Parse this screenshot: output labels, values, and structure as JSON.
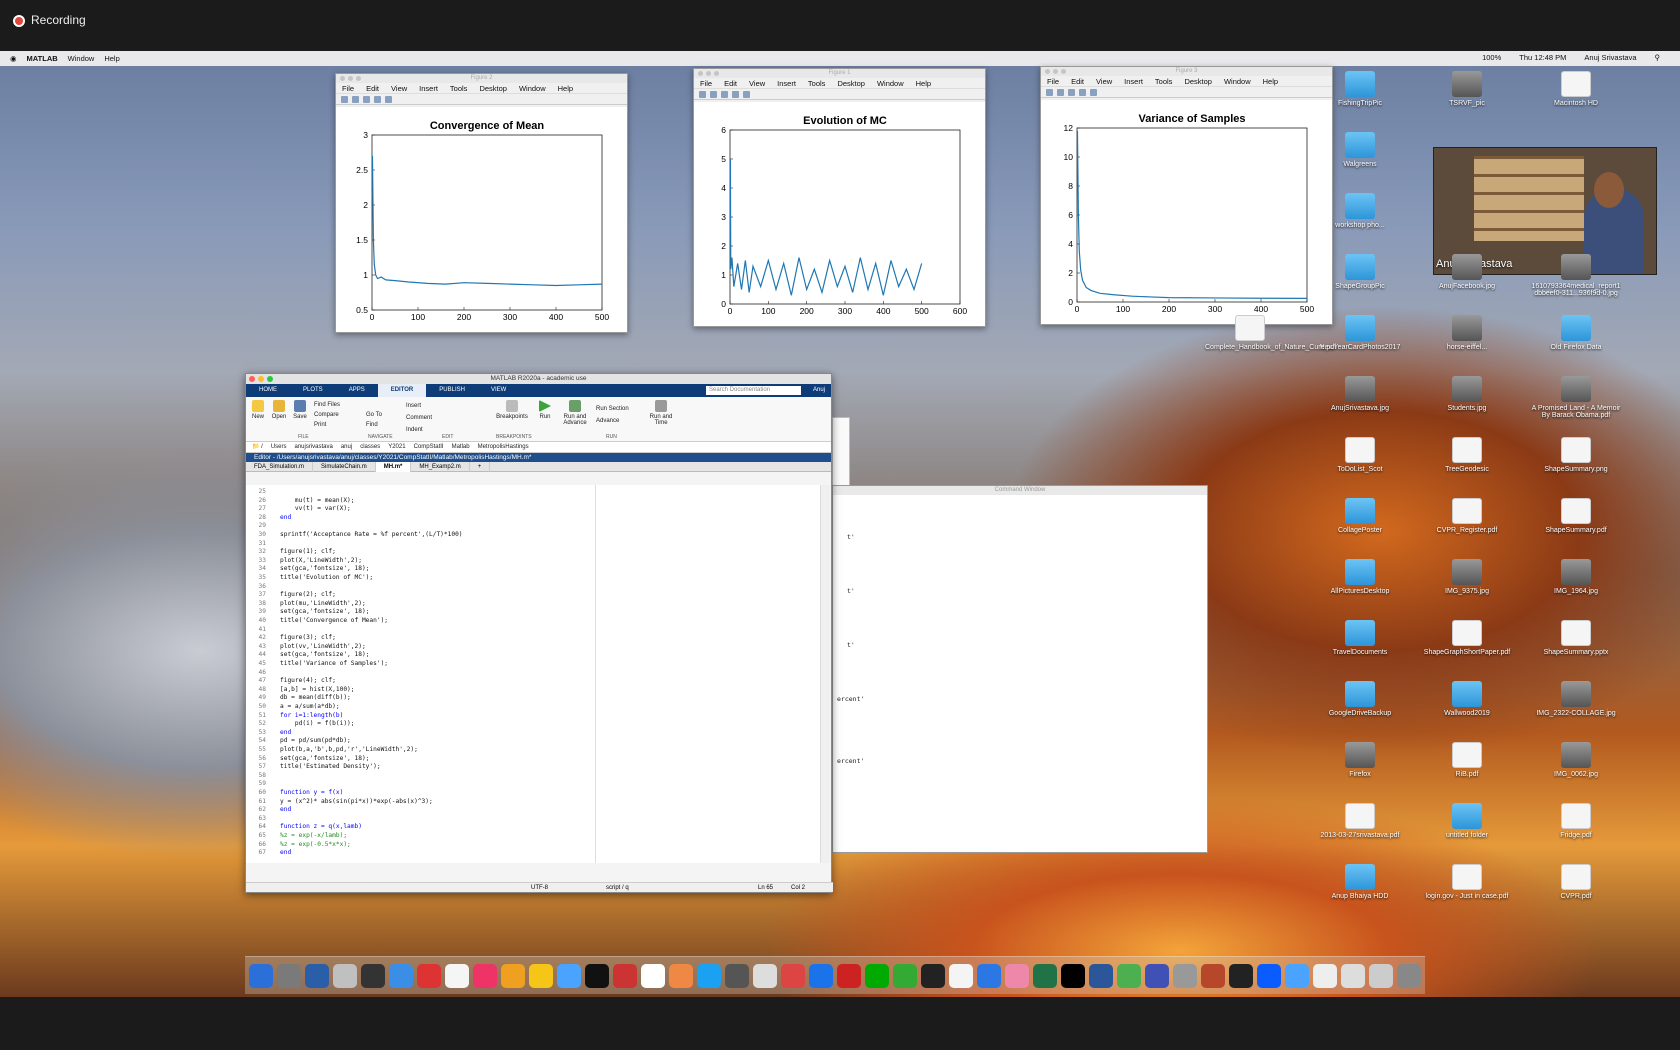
{
  "recording": {
    "label": "Recording"
  },
  "menubar": {
    "apple": "",
    "app": "MATLAB",
    "items": [
      "Window",
      "Help"
    ],
    "time": "Thu 12:48 PM",
    "user": "Anuj Srivastava",
    "battery": "100%"
  },
  "figures": [
    {
      "title": "Figure 2",
      "menu": [
        "File",
        "Edit",
        "View",
        "Insert",
        "Tools",
        "Desktop",
        "Window",
        "Help"
      ]
    },
    {
      "title": "Figure 1",
      "menu": [
        "File",
        "Edit",
        "View",
        "Insert",
        "Tools",
        "Desktop",
        "Window",
        "Help"
      ]
    },
    {
      "title": "Figure 3",
      "menu": [
        "File",
        "Edit",
        "View",
        "Insert",
        "Tools",
        "Desktop",
        "Window",
        "Help"
      ]
    }
  ],
  "chart_data": [
    {
      "type": "line",
      "title": "Convergence of Mean",
      "xlim": [
        0,
        500
      ],
      "ylim": [
        0.5,
        3
      ],
      "xticks": [
        "0",
        "100",
        "200",
        "300",
        "400",
        "500"
      ],
      "yticks": [
        "0.5",
        "1",
        "1.5",
        "2",
        "2.5",
        "3"
      ],
      "series": [
        {
          "x": [
            1,
            3,
            5,
            8,
            12,
            20,
            30,
            50,
            80,
            120,
            160,
            200,
            250,
            300,
            350,
            400,
            450,
            500
          ],
          "y": [
            2.7,
            1.5,
            1.15,
            1.0,
            0.95,
            0.97,
            0.93,
            0.92,
            0.9,
            0.88,
            0.87,
            0.89,
            0.88,
            0.87,
            0.86,
            0.85,
            0.86,
            0.87
          ]
        }
      ]
    },
    {
      "type": "line",
      "title": "Evolution of MC",
      "xlim": [
        0,
        600
      ],
      "ylim": [
        0,
        6
      ],
      "xticks": [
        "0",
        "100",
        "200",
        "300",
        "400",
        "500",
        "600"
      ],
      "yticks": [
        "0",
        "1",
        "2",
        "3",
        "4",
        "5",
        "6"
      ],
      "series": [
        {
          "x": [
            1,
            2,
            5,
            10,
            20,
            30,
            40,
            50,
            60,
            80,
            100,
            120,
            140,
            160,
            180,
            200,
            220,
            240,
            260,
            280,
            300,
            320,
            340,
            360,
            380,
            400,
            420,
            440,
            460,
            480,
            500
          ],
          "y": [
            5.0,
            1.2,
            1.6,
            0.6,
            1.4,
            0.5,
            1.5,
            0.4,
            1.3,
            0.6,
            1.5,
            0.5,
            1.4,
            0.3,
            1.6,
            0.5,
            1.2,
            0.4,
            1.5,
            0.6,
            1.3,
            0.4,
            1.6,
            0.5,
            1.4,
            0.3,
            1.5,
            0.6,
            1.2,
            0.5,
            1.4
          ]
        }
      ]
    },
    {
      "type": "line",
      "title": "Variance of Samples",
      "xlim": [
        0,
        500
      ],
      "ylim": [
        0,
        12
      ],
      "xticks": [
        "0",
        "100",
        "200",
        "300",
        "400",
        "500"
      ],
      "yticks": [
        "0",
        "2",
        "4",
        "6",
        "8",
        "10",
        "12"
      ],
      "series": [
        {
          "x": [
            1,
            3,
            5,
            8,
            12,
            20,
            30,
            50,
            80,
            120,
            160,
            200,
            300,
            400,
            500
          ],
          "y": [
            11.8,
            6.0,
            3.5,
            2.2,
            1.5,
            1.0,
            0.8,
            0.6,
            0.5,
            0.4,
            0.35,
            0.3,
            0.28,
            0.26,
            0.25
          ]
        }
      ]
    }
  ],
  "matlab": {
    "title": "MATLAB R2020a - academic use",
    "tabs": [
      "HOME",
      "PLOTS",
      "APPS",
      "EDITOR",
      "PUBLISH",
      "VIEW"
    ],
    "search_placeholder": "Search Documentation",
    "user": "Anuj",
    "toolstrip": {
      "new": "New",
      "open": "Open",
      "save": "Save",
      "find_files": "Find Files",
      "compare": "Compare",
      "print": "Print",
      "goto": "Go To",
      "find": "Find",
      "insert": "Insert",
      "comment": "Comment",
      "indent": "Indent",
      "breakpoints": "Breakpoints",
      "run": "Run",
      "run_advance": "Run and Advance",
      "run_section": "Run Section",
      "advance": "Advance",
      "run_time": "Run and Time",
      "sections": [
        "FILE",
        "NAVIGATE",
        "EDIT",
        "BREAKPOINTS",
        "RUN"
      ]
    },
    "path": [
      "Users",
      "anujsrivastava",
      "anuj",
      "classes",
      "Y2021",
      "CompStatII",
      "Matlab",
      "MetropolisHastings"
    ],
    "editor_header": "Editor - /Users/anujsrivastava/anuj/classes/Y2021/CompStatII/Matlab/MetropolisHastings/MH.m*",
    "file_tabs": [
      "FDA_Simulation.m",
      "SimulateChain.m",
      "MH.m*",
      "MH_Examp2.m"
    ],
    "code": [
      {
        "n": "25",
        "t": ""
      },
      {
        "n": "26",
        "t": "    mu(t) = mean(X);"
      },
      {
        "n": "27",
        "t": "    vv(t) = var(X);"
      },
      {
        "n": "28",
        "t": "end"
      },
      {
        "n": "29",
        "t": ""
      },
      {
        "n": "30",
        "t": "sprintf('Acceptance Rate = %f percent',(L/T)*100)"
      },
      {
        "n": "31",
        "t": ""
      },
      {
        "n": "32",
        "t": "figure(1); clf;"
      },
      {
        "n": "33",
        "t": "plot(X,'LineWidth',2);"
      },
      {
        "n": "34",
        "t": "set(gca,'fontsize', 18);"
      },
      {
        "n": "35",
        "t": "title('Evolution of MC');"
      },
      {
        "n": "36",
        "t": ""
      },
      {
        "n": "37",
        "t": "figure(2); clf;"
      },
      {
        "n": "38",
        "t": "plot(mu,'LineWidth',2);"
      },
      {
        "n": "39",
        "t": "set(gca,'fontsize', 18);"
      },
      {
        "n": "40",
        "t": "title('Convergence of Mean');"
      },
      {
        "n": "41",
        "t": ""
      },
      {
        "n": "42",
        "t": "figure(3); clf;"
      },
      {
        "n": "43",
        "t": "plot(vv,'LineWidth',2);"
      },
      {
        "n": "44",
        "t": "set(gca,'fontsize', 18);"
      },
      {
        "n": "45",
        "t": "title('Variance of Samples');"
      },
      {
        "n": "46",
        "t": ""
      },
      {
        "n": "47",
        "t": "figure(4); clf;"
      },
      {
        "n": "48",
        "t": "[a,b] = hist(X,100);"
      },
      {
        "n": "49",
        "t": "db = mean(diff(b));"
      },
      {
        "n": "50",
        "t": "a = a/sum(a*db);"
      },
      {
        "n": "51",
        "t": "for i=1:length(b)"
      },
      {
        "n": "52",
        "t": "    pd(i) = f(b(i));"
      },
      {
        "n": "53",
        "t": "end"
      },
      {
        "n": "54",
        "t": "pd = pd/sum(pd*db);"
      },
      {
        "n": "55",
        "t": "plot(b,a,'b',b,pd,'r','LineWidth',2);"
      },
      {
        "n": "56",
        "t": "set(gca,'fontsize', 18);"
      },
      {
        "n": "57",
        "t": "title('Estimated Density');"
      },
      {
        "n": "58",
        "t": ""
      },
      {
        "n": "59",
        "t": ""
      },
      {
        "n": "60",
        "t": "function y = f(x)"
      },
      {
        "n": "61",
        "t": "y = (x^2)* abs(sin(pi*x))*exp(-abs(x)^3);"
      },
      {
        "n": "62",
        "t": "end"
      },
      {
        "n": "63",
        "t": ""
      },
      {
        "n": "64",
        "t": "function z = q(x,lamb)"
      },
      {
        "n": "65",
        "t": "%z = exp(-x/lamb);"
      },
      {
        "n": "66",
        "t": "%z = exp(-0.5*x*x);"
      },
      {
        "n": "67",
        "t": "end"
      }
    ],
    "status": {
      "encoding": "UTF-8",
      "type": "script / q",
      "ln": "Ln  65",
      "col": "Col  2"
    }
  },
  "command_window": {
    "title": "Command Window",
    "lines": [
      "t'",
      "t'",
      "t'",
      "ercent'",
      "ercent'"
    ]
  },
  "video": {
    "name": "Anuj Srivastava"
  },
  "desktop_icons": [
    {
      "label": "FishingTripPic",
      "kind": "folder",
      "col": 0,
      "row": 0
    },
    {
      "label": "TSRVF_pic",
      "kind": "img",
      "col": 1,
      "row": 0
    },
    {
      "label": "Macintosh HD",
      "kind": "doc",
      "col": 2,
      "row": 0
    },
    {
      "label": "Walgreens",
      "kind": "folder",
      "col": 0,
      "row": 1
    },
    {
      "label": "workshop pho...",
      "kind": "folder",
      "col": 0,
      "row": 2
    },
    {
      "label": "ShapeGroupPic",
      "kind": "folder",
      "col": 0,
      "row": 3
    },
    {
      "label": "AnujFacebook.jpg",
      "kind": "img",
      "col": 1,
      "row": 3
    },
    {
      "label": "1610793364medical_report1 dbbeef0-311...936f9d-0.jpg",
      "kind": "img",
      "col": 2,
      "row": 3
    },
    {
      "label": "NewYearCardPhotos2017",
      "kind": "folder",
      "col": 0,
      "row": 4
    },
    {
      "label": "horse-eiffel...",
      "kind": "img",
      "col": 1,
      "row": 4
    },
    {
      "label": "Old Firefox Data",
      "kind": "folder",
      "col": 2,
      "row": 4
    },
    {
      "label": "AnujSrivastava.jpg",
      "kind": "img",
      "col": 0,
      "row": 5
    },
    {
      "label": "Students.jpg",
      "kind": "img",
      "col": 1,
      "row": 5
    },
    {
      "label": "A Promised Land - A Memoir By Barack Obama.pdf",
      "kind": "img",
      "col": 2,
      "row": 5
    },
    {
      "label": "ToDoList_Scot",
      "kind": "doc",
      "col": 0,
      "row": 6
    },
    {
      "label": "TreeGeodesic",
      "kind": "doc",
      "col": 1,
      "row": 6
    },
    {
      "label": "ShapeSummary.png",
      "kind": "doc",
      "col": 2,
      "row": 6
    },
    {
      "label": "CollagePoster",
      "kind": "folder",
      "col": 0,
      "row": 7
    },
    {
      "label": "CVPR_Register.pdf",
      "kind": "doc",
      "col": 1,
      "row": 7
    },
    {
      "label": "ShapeSummary.pdf",
      "kind": "doc",
      "col": 2,
      "row": 7
    },
    {
      "label": "AllPicturesDesktop",
      "kind": "folder",
      "col": 0,
      "row": 8
    },
    {
      "label": "IMG_9375.jpg",
      "kind": "img",
      "col": 1,
      "row": 8
    },
    {
      "label": "IMG_1964.jpg",
      "kind": "img",
      "col": 2,
      "row": 8
    },
    {
      "label": "TravelDocuments",
      "kind": "folder",
      "col": 0,
      "row": 9
    },
    {
      "label": "ShapeGraphShortPaper.pdf",
      "kind": "doc",
      "col": 1,
      "row": 9
    },
    {
      "label": "ShapeSummary.pptx",
      "kind": "doc",
      "col": 2,
      "row": 9
    },
    {
      "label": "GoogleDriveBackup",
      "kind": "folder",
      "col": 0,
      "row": 10
    },
    {
      "label": "Wallwood2019",
      "kind": "folder",
      "col": 1,
      "row": 10
    },
    {
      "label": "IMG_2322-COLLAGE.jpg",
      "kind": "img",
      "col": 2,
      "row": 10
    },
    {
      "label": "Firefox",
      "kind": "img",
      "col": 0,
      "row": 11
    },
    {
      "label": "RiB.pdf",
      "kind": "doc",
      "col": 1,
      "row": 11
    },
    {
      "label": "IMG_0062.jpg",
      "kind": "img",
      "col": 2,
      "row": 11
    },
    {
      "label": "2013-03-27srivastava.pdf",
      "kind": "doc",
      "col": 0,
      "row": 12
    },
    {
      "label": "untitled folder",
      "kind": "folder",
      "col": 1,
      "row": 12
    },
    {
      "label": "Fridge.pdf",
      "kind": "doc",
      "col": 2,
      "row": 12
    },
    {
      "label": "Anup Bhaiya HDD",
      "kind": "folder",
      "col": 0,
      "row": 13
    },
    {
      "label": "login.gov - Just in case.pdf",
      "kind": "doc",
      "col": 1,
      "row": 13
    },
    {
      "label": "CVPR.pdf",
      "kind": "doc",
      "col": 2,
      "row": 13
    },
    {
      "label": "Complete_Handbook_of_Nature_Cure.pdf",
      "kind": "doc",
      "col": -1,
      "row": 4
    }
  ],
  "dock_count": 42,
  "colors": {
    "plot_line": "#1f77b4",
    "matlab_blue": "#0e3c78",
    "keyword": "#0000ff",
    "string": "#a020f0",
    "comment": "#228b22"
  }
}
